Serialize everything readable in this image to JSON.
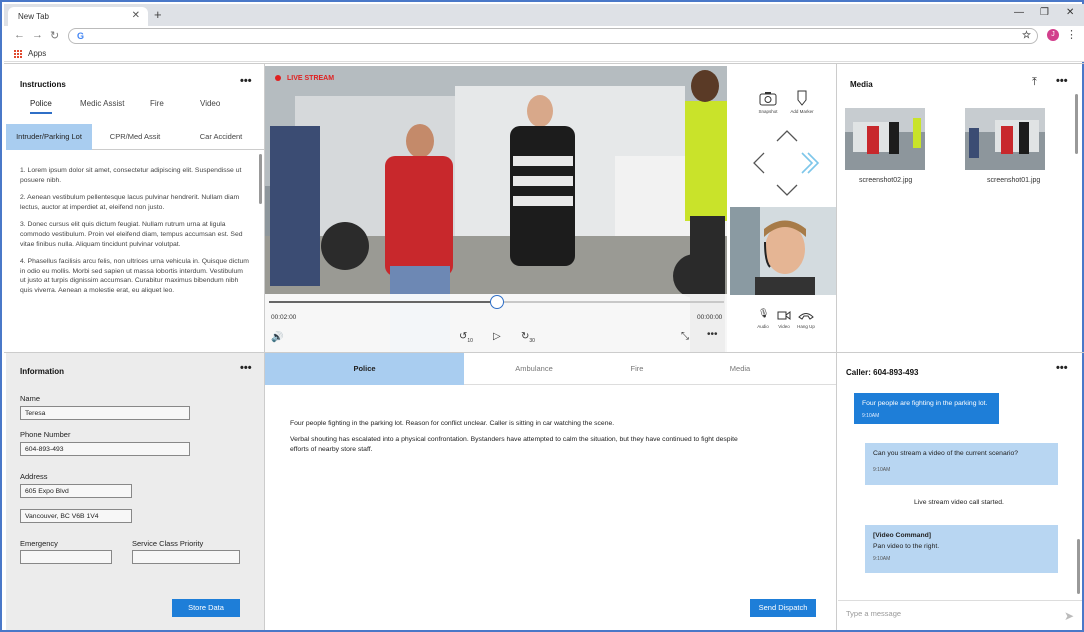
{
  "browser": {
    "tab_title": "New Tab",
    "omnibox_value": "G",
    "bookmark_apps": "Apps",
    "avatar_letter": "J"
  },
  "instructions": {
    "title": "Instructions",
    "tabs": [
      "Police",
      "Medic Assist",
      "Fire",
      "Video"
    ],
    "subtabs": [
      "Intruder/Parking Lot",
      "CPR/Med Assit",
      "Car Accident"
    ],
    "paragraphs": [
      "1. Lorem ipsum dolor sit amet, consectetur adipiscing elit. Suspendisse ut posuere nibh.",
      "2. Aenean vestibulum pellentesque lacus pulvinar hendrerit. Nullam diam lectus, auctor at imperdiet at, eleifend non justo.",
      "3. Donec cursus elit quis dictum feugiat. Nullam rutrum urna at ligula commodo vestibulum. Proin vel eleifend diam, tempus accumsan est. Sed vitae finibus nulla. Aliquam tincidunt pulvinar volutpat.",
      "4. Phasellus facilisis arcu felis, non ultrices urna vehicula in. Quisque dictum in odio eu mollis. Morbi sed sapien ut massa lobortis interdum. Vestibulum ut justo at turpis dignissim accumsan. Curabitur maximus bibendum nibh quis viverra. Aenean a molestie erat, eu aliquet leo."
    ]
  },
  "information": {
    "title": "Information",
    "name_label": "Name",
    "name_value": "Teresa",
    "phone_label": "Phone Number",
    "phone_value": "604-893-493",
    "address_label": "Address",
    "address_line1": "605 Expo Blvd",
    "address_line2": "Vancouver, BC V6B 1V4",
    "emergency_label": "Emergency",
    "emergency_value": "",
    "priority_label": "Service Class Priority",
    "priority_value": "",
    "store_button": "Store Data"
  },
  "video": {
    "live_label": "LIVE STREAM",
    "time_current": "00:02:00",
    "time_total": "00:00:00",
    "progress": 0.5,
    "rewind_label": "10",
    "forward_label": "30"
  },
  "side_controls": {
    "snapshot": "Snapshot",
    "add_marker": "Add Marker",
    "audio": "Audio",
    "video": "Video",
    "hang_up": "Hang Up"
  },
  "media": {
    "title": "Media",
    "items": [
      "screenshot02.jpg",
      "screenshot01.jpg"
    ]
  },
  "dispatch": {
    "tabs": [
      "Police",
      "Ambulance",
      "Fire",
      "Media"
    ],
    "paragraphs": [
      "Four people fighting in the parking lot. Reason for conflict unclear. Caller is sitting in car watching the scene.",
      "Verbal shouting has escalated into a physical confrontation. Bystanders have attempted to calm the situation, but they have continued to fight despite efforts of nearby store staff."
    ],
    "send_button": "Send Dispatch"
  },
  "chat": {
    "title": "Caller: 604-893-493",
    "msg1": "Four people are fighting in the parking lot.",
    "msg1_time": "9:10AM",
    "msg2": "Can you stream a video of the current scenario?",
    "msg2_time": "9:10AM",
    "system": "Live stream video call started.",
    "msg3_head": "[Video Command]",
    "msg3": "Pan video to the right.",
    "msg3_time": "9:10AM",
    "input_placeholder": "Type a message"
  },
  "colors": {
    "accent": "#1e7ed8",
    "tab_highlight": "#a9cdf0",
    "live_red": "#e02020"
  }
}
